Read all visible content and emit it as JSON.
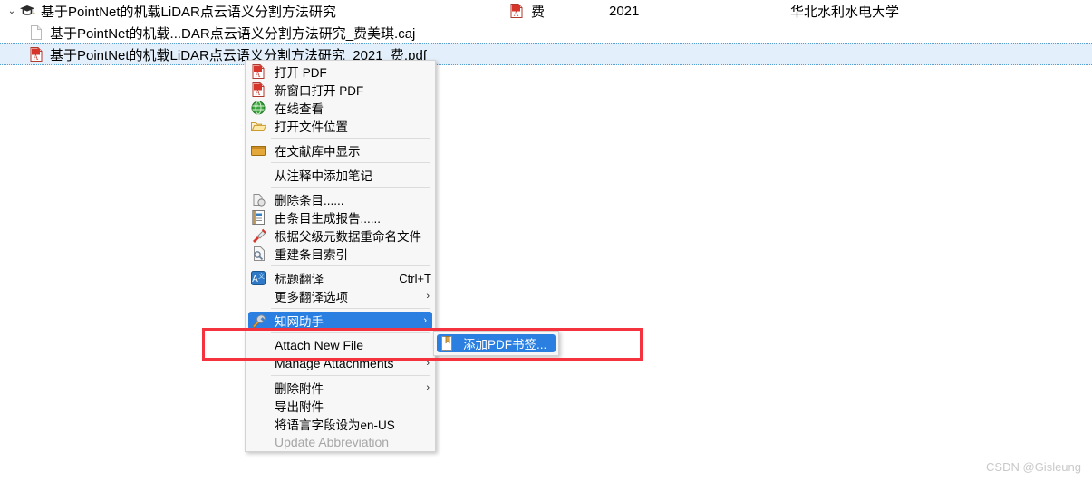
{
  "tree": {
    "rows": [
      {
        "level": 0,
        "icon": "graduation-cap-icon",
        "expander": "chevron-down-icon",
        "expander_glyph": "⌄",
        "label": "基于PointNet的机载LiDAR点云语义分割方法研究",
        "author": "费",
        "year": "2021",
        "publisher": "华北水利水电大学",
        "author_icon": "pdf-icon",
        "selected": false
      },
      {
        "level": 1,
        "icon": "document-icon",
        "label": "基于PointNet的机载...DAR点云语义分割方法研究_费美琪.caj",
        "selected": false
      },
      {
        "level": 1,
        "icon": "pdf-icon",
        "label": "基于PointNet的机载LiDAR点云语义分割方法研究_2021_费.pdf",
        "selected": true
      }
    ]
  },
  "context_menu": {
    "items": [
      {
        "type": "item",
        "icon": "pdf-icon",
        "label": "打开 PDF",
        "accel": "",
        "arrow": false,
        "disabled": false,
        "highlight": false
      },
      {
        "type": "item",
        "icon": "pdf-icon",
        "label": "新窗口打开 PDF",
        "accel": "",
        "arrow": false,
        "disabled": false,
        "highlight": false
      },
      {
        "type": "item",
        "icon": "globe-icon",
        "label": "在线查看",
        "accel": "",
        "arrow": false,
        "disabled": false,
        "highlight": false
      },
      {
        "type": "item",
        "icon": "open-folder-icon",
        "label": "打开文件位置",
        "accel": "",
        "arrow": false,
        "disabled": false,
        "highlight": false
      },
      {
        "type": "sep"
      },
      {
        "type": "item",
        "icon": "library-icon",
        "label": "在文献库中显示",
        "accel": "",
        "arrow": false,
        "disabled": false,
        "highlight": false
      },
      {
        "type": "sep"
      },
      {
        "type": "item",
        "icon": "none",
        "label": "从注释中添加笔记",
        "accel": "",
        "arrow": false,
        "disabled": false,
        "highlight": false
      },
      {
        "type": "sep"
      },
      {
        "type": "item",
        "icon": "delete-item-icon",
        "label": "删除条目......",
        "accel": "",
        "arrow": false,
        "disabled": false,
        "highlight": false
      },
      {
        "type": "item",
        "icon": "report-icon",
        "label": "由条目生成报告......",
        "accel": "",
        "arrow": false,
        "disabled": false,
        "highlight": false
      },
      {
        "type": "item",
        "icon": "rename-icon",
        "label": "根据父级元数据重命名文件",
        "accel": "",
        "arrow": false,
        "disabled": false,
        "highlight": false
      },
      {
        "type": "item",
        "icon": "reindex-icon",
        "label": "重建条目索引",
        "accel": "",
        "arrow": false,
        "disabled": false,
        "highlight": false
      },
      {
        "type": "sep"
      },
      {
        "type": "item",
        "icon": "translate-icon",
        "label": "标题翻译",
        "accel": "Ctrl+T",
        "arrow": false,
        "disabled": false,
        "highlight": false
      },
      {
        "type": "item",
        "icon": "none",
        "label": "更多翻译选项",
        "accel": "",
        "arrow": true,
        "disabled": false,
        "highlight": false
      },
      {
        "type": "sep"
      },
      {
        "type": "item",
        "icon": "wrench-icon",
        "label": "知网助手",
        "accel": "",
        "arrow": true,
        "disabled": false,
        "highlight": true
      },
      {
        "type": "sep"
      },
      {
        "type": "item",
        "icon": "none",
        "label": "Attach New File",
        "accel": "",
        "arrow": false,
        "disabled": false,
        "highlight": false,
        "latin": true
      },
      {
        "type": "item",
        "icon": "none",
        "label": "Manage Attachments",
        "accel": "",
        "arrow": true,
        "disabled": false,
        "highlight": false,
        "latin": true
      },
      {
        "type": "sep"
      },
      {
        "type": "item",
        "icon": "none",
        "label": "删除附件",
        "accel": "",
        "arrow": true,
        "disabled": false,
        "highlight": false
      },
      {
        "type": "item",
        "icon": "none",
        "label": "导出附件",
        "accel": "",
        "arrow": false,
        "disabled": false,
        "highlight": false
      },
      {
        "type": "item",
        "icon": "none",
        "label": "将语言字段设为en-US",
        "accel": "",
        "arrow": false,
        "disabled": false,
        "highlight": false
      },
      {
        "type": "item",
        "icon": "none",
        "label": "Update Abbreviation",
        "accel": "",
        "arrow": false,
        "disabled": true,
        "highlight": false,
        "latin": true
      }
    ]
  },
  "submenu": {
    "items": [
      {
        "type": "item",
        "icon": "bookmark-icon",
        "label": "添加PDF书签...",
        "accel": "",
        "arrow": false,
        "disabled": false,
        "highlight": true
      }
    ]
  },
  "annotation": {
    "color": "#f5333f",
    "shape": "rectangle"
  },
  "watermark": {
    "text": "CSDN @Gisleung"
  },
  "colors": {
    "selection_row": "#e3effb",
    "menu_highlight": "#2a7fe0",
    "menu_background": "#f7f7f7",
    "annotation_red": "#f5333f"
  }
}
